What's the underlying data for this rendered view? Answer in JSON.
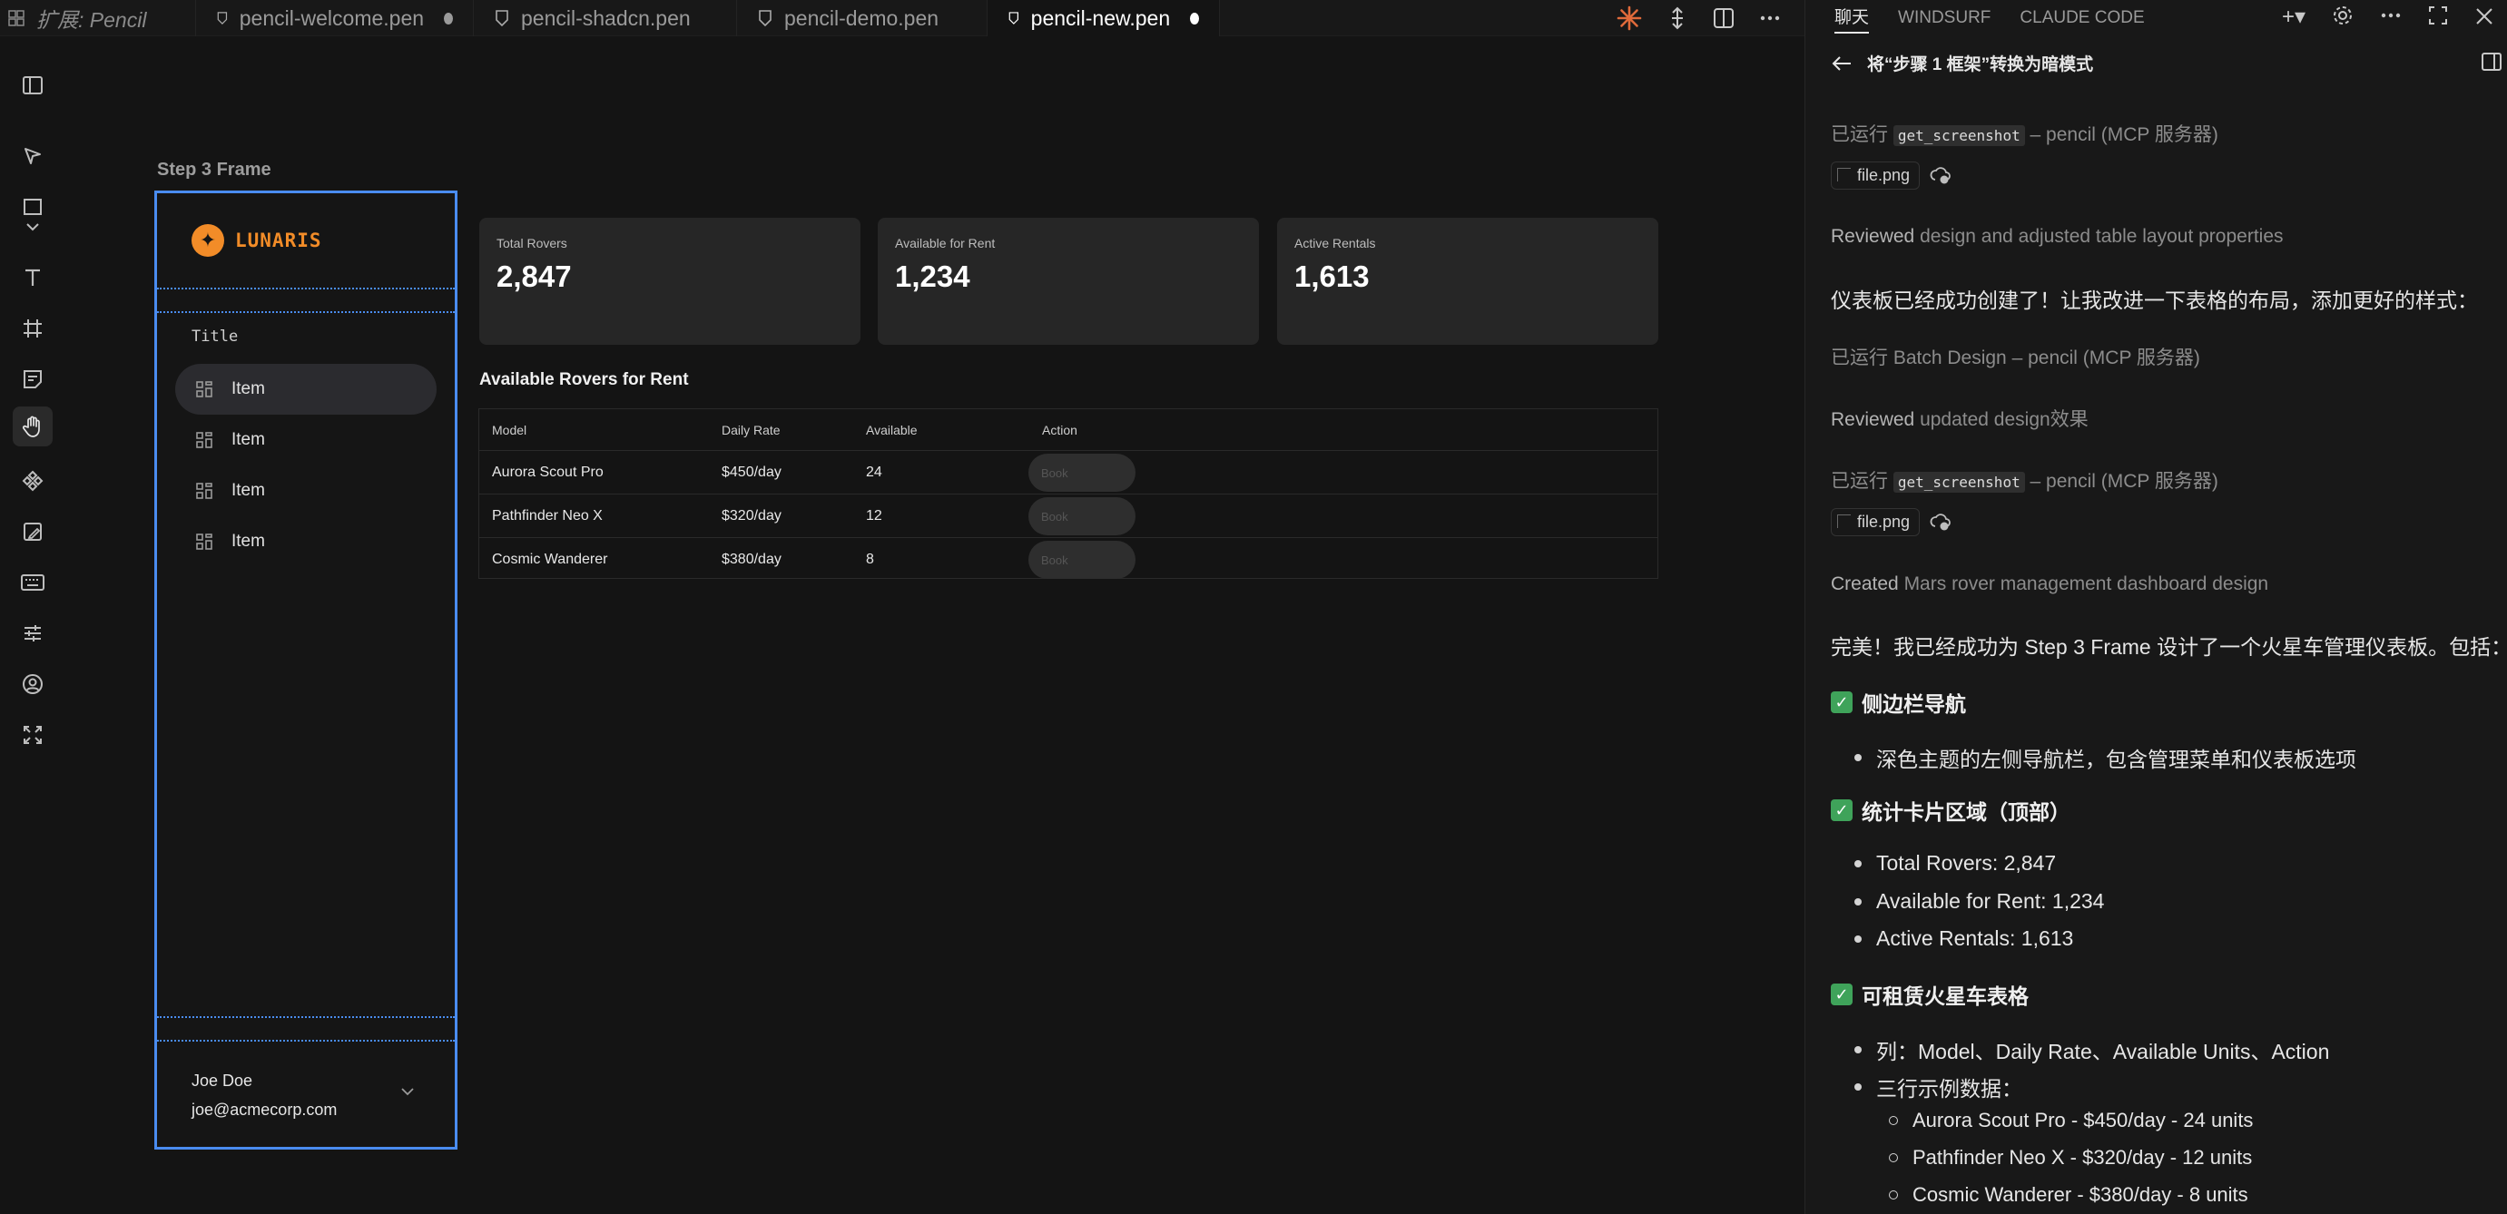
{
  "tabs": {
    "extension": "扩展: Pencil",
    "items": [
      {
        "label": "pencil-welcome.pen"
      },
      {
        "label": "pencil-shadcn.pen"
      },
      {
        "label": "pencil-demo.pen"
      },
      {
        "label": "pencil-new.pen"
      }
    ]
  },
  "canvas": {
    "frame_label": "Step 3 Frame",
    "sidebar": {
      "brand": "LUNARIS",
      "section_title": "Title",
      "items": [
        "Item",
        "Item",
        "Item",
        "Item"
      ],
      "user_name": "Joe Doe",
      "user_email": "joe@acmecorp.com"
    },
    "stats": [
      {
        "label": "Total Rovers",
        "value": "2,847"
      },
      {
        "label": "Available for Rent",
        "value": "1,234"
      },
      {
        "label": "Active Rentals",
        "value": "1,613"
      }
    ],
    "table": {
      "title": "Available Rovers for Rent",
      "columns": [
        "Model",
        "Daily Rate",
        "Available",
        "Action"
      ],
      "rows": [
        {
          "model": "Aurora Scout Pro",
          "rate": "$450/day",
          "available": "24",
          "action": "Book"
        },
        {
          "model": "Pathfinder Neo X",
          "rate": "$320/day",
          "available": "12",
          "action": "Book"
        },
        {
          "model": "Cosmic Wanderer",
          "rate": "$380/day",
          "available": "8",
          "action": "Book"
        }
      ]
    }
  },
  "panel": {
    "tabs": [
      "聊天",
      "WINDSURF",
      "CLAUDE CODE"
    ],
    "conversation_title": "将“步骤 1 框架”转换为暗模式",
    "messages": {
      "ran_1_prefix": "已运行",
      "ran_1_code": "get_screenshot",
      "ran_1_suffix": "– pencil (MCP 服务器)",
      "file_1": "file.png",
      "reviewed_1_verb": "Reviewed",
      "reviewed_1_text": "design and adjusted table layout properties",
      "info_1": "仪表板已经成功创建了！让我改进一下表格的布局，添加更好的样式：",
      "ran_2": "已运行 Batch Design – pencil (MCP 服务器)",
      "reviewed_2_verb": "Reviewed",
      "reviewed_2_text": "updated design效果",
      "ran_3_prefix": "已运行",
      "ran_3_code": "get_screenshot",
      "ran_3_suffix": "– pencil (MCP 服务器)",
      "file_2": "file.png",
      "created_verb": "Created",
      "created_text": "Mars rover management dashboard design",
      "summary": "完美！我已经成功为 Step 3 Frame 设计了一个火星车管理仪表板。包括：",
      "h1": "侧边栏导航",
      "h1_b1": "深色主题的左侧导航栏，包含管理菜单和仪表板选项",
      "h2": "统计卡片区域（顶部）",
      "h2_b1": "Total Rovers: 2,847",
      "h2_b2": "Available for Rent: 1,234",
      "h2_b3": "Active Rentals: 1,613",
      "h3": "可租赁火星车表格",
      "h3_b1": "列：Model、Daily Rate、Available Units、Action",
      "h3_b2": "三行示例数据：",
      "h3_s1": "Aurora Scout Pro - $450/day - 24 units",
      "h3_s2": "Pathfinder Neo X - $320/day - 12 units",
      "h3_s3": "Cosmic Wanderer - $380/day - 8 units"
    }
  },
  "colors": {
    "accent": "#f28c28",
    "selection": "#4a8cf0",
    "check": "#3fa35a"
  }
}
